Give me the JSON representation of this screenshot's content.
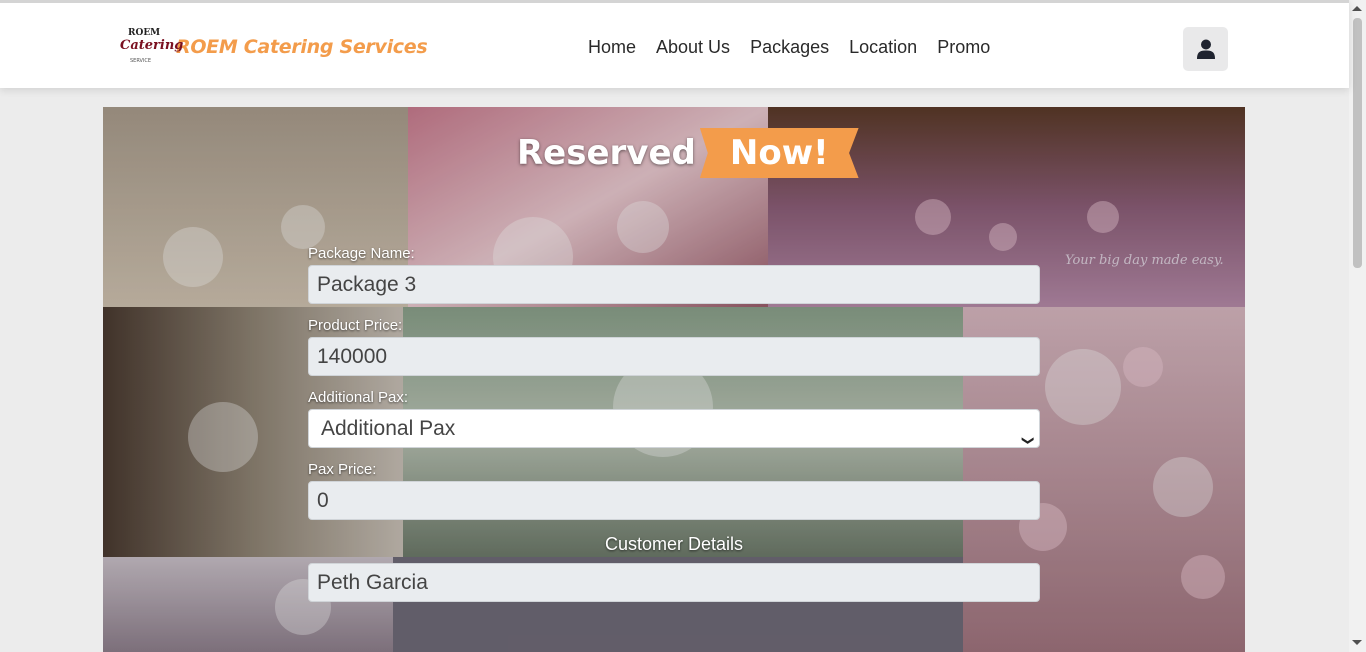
{
  "brand": {
    "logo_line1": "ROEM",
    "logo_line2": "Catering",
    "logo_line3": "SERVICE",
    "name": "ROEM Catering Services"
  },
  "nav": {
    "items": [
      {
        "label": "Home"
      },
      {
        "label": "About Us"
      },
      {
        "label": "Packages"
      },
      {
        "label": "Location"
      },
      {
        "label": "Promo"
      }
    ]
  },
  "header": {
    "user_icon": "user-icon"
  },
  "hero": {
    "title_part1": "Reserved",
    "title_part2": "Now!",
    "watermark": "Your big day made easy."
  },
  "form": {
    "package_label": "Package Name:",
    "package_value": "Package 3",
    "price_label": "Product Price:",
    "price_value": "140000",
    "pax_label": "Additional Pax:",
    "pax_selected": "Additional Pax",
    "pax_price_label": "Pax Price:",
    "pax_price_value": "0",
    "customer_section": "Customer Details",
    "customer_name_value": "Peth Garcia"
  },
  "colors": {
    "accent": "#f39c4b",
    "navbar": "#ffffff",
    "page_bg": "#ececec"
  }
}
